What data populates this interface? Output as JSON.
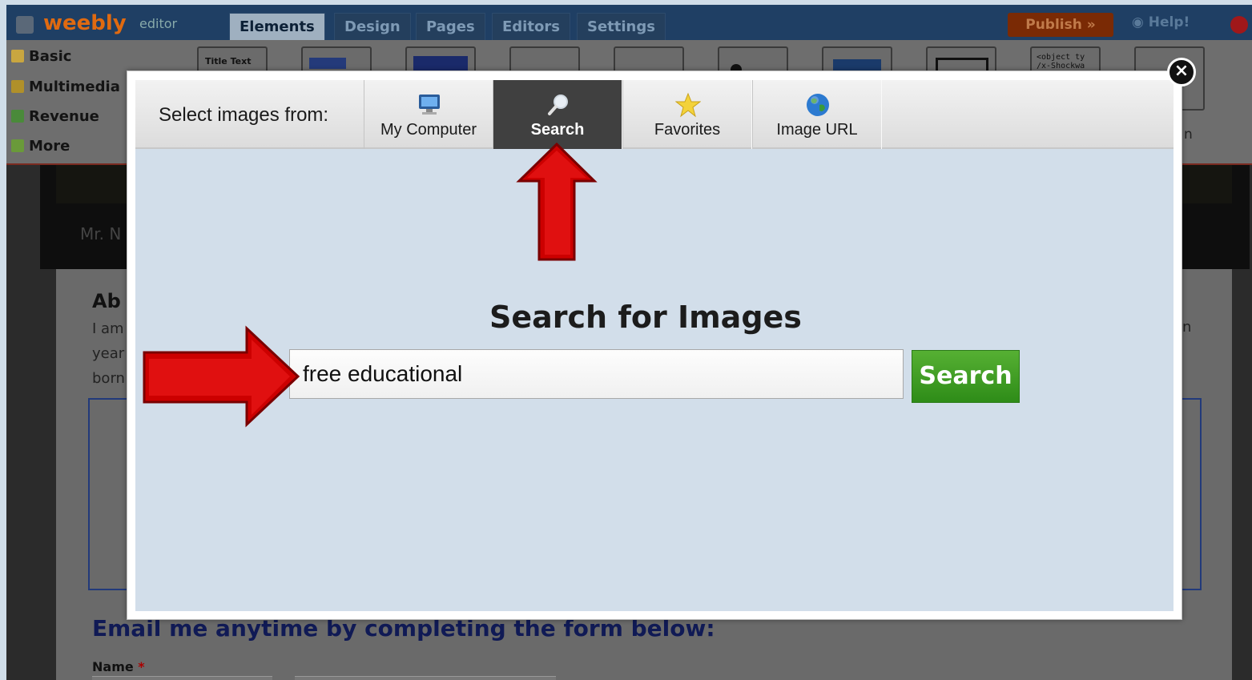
{
  "editor": {
    "logo": "weebly",
    "logo_suffix": "editor",
    "tabs": [
      "Elements",
      "Design",
      "Pages",
      "Editors",
      "Settings"
    ],
    "active_tab": "Elements",
    "publish_label": "Publish »",
    "help_label": "Help!",
    "sidebar": [
      "Basic",
      "Multimedia",
      "Revenue",
      "More"
    ],
    "tool_tiles": [
      "Title Text",
      "<object ty /x-Shockwa"
    ]
  },
  "background_page": {
    "banner_text": "Mr. N",
    "heading": "Ab",
    "lines": [
      "I am",
      "year",
      "born"
    ],
    "right_fragment": "n",
    "email_prompt": "Email me anytime by completing the form below:",
    "name_label": "Name",
    "required_mark": "*"
  },
  "modal": {
    "select_label": "Select images from:",
    "tabs": [
      {
        "label": "My Computer",
        "icon": "computer-icon"
      },
      {
        "label": "Search",
        "icon": "magnifier-icon",
        "active": true
      },
      {
        "label": "Favorites",
        "icon": "star-icon"
      },
      {
        "label": "Image URL",
        "icon": "globe-icon"
      }
    ],
    "close_icon": "close-icon",
    "search_title": "Search for Images",
    "search_input_value": "free educational",
    "search_button_label": "Search"
  },
  "annotations": {
    "arrow_color": "#cc0000"
  }
}
